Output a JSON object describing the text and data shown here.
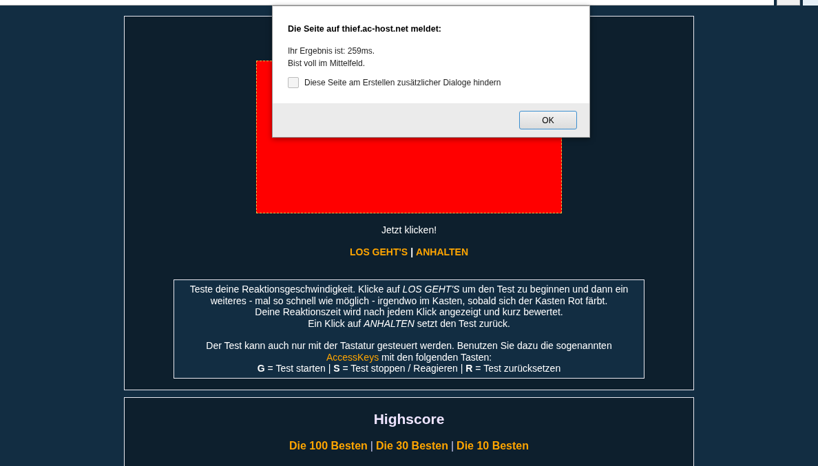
{
  "test": {
    "prompt": "Jetzt klicken!",
    "box_active": true,
    "actions": [
      {
        "label": "LOS GEHT'S"
      },
      {
        "label": "ANHALTEN"
      }
    ],
    "separator": "|",
    "info": {
      "lines": [
        "Teste deine Reaktionsgeschwindigkeit. Klicke auf *LOS GEHT'S* um den Test zu beginnen und dann ein weiteres - mal so schnell wie möglich - irgendwo im Kasten, sobald sich der Kasten Rot färbt.",
        "Deine Reaktionszeit wird nach jedem Klick angezeigt und kurz bewertet.",
        "Ein Klick auf *ANHALTEN* setzt den Test zurück."
      ],
      "keyboard_before": "Der Test kann auch nur mit der Tastatur gesteuert werden. Benutzen Sie dazu die sogenannten",
      "keyboard_link": "AccessKeys",
      "keyboard_after": "mit den folgenden Tasten:",
      "keys": "**G** = Test starten | **S** = Test stoppen / Reagieren | **R** = Test zurücksetzen"
    }
  },
  "highscore": {
    "title": "Highscore",
    "separator": "|",
    "links": [
      {
        "label": "Die 100 Besten"
      },
      {
        "label": "Die 30 Besten"
      },
      {
        "label": "Die 10 Besten"
      }
    ]
  },
  "dialog": {
    "title": "Die Seite auf thief.ac-host.net meldet:",
    "messages": [
      "Ihr Ergebnis ist: 259ms.",
      "Bist voll im Mittelfeld."
    ],
    "checkbox": {
      "label": "Diese Seite am Erstellen zusätzlicher Dialoge hindern",
      "checked": false
    },
    "button": "OK"
  }
}
